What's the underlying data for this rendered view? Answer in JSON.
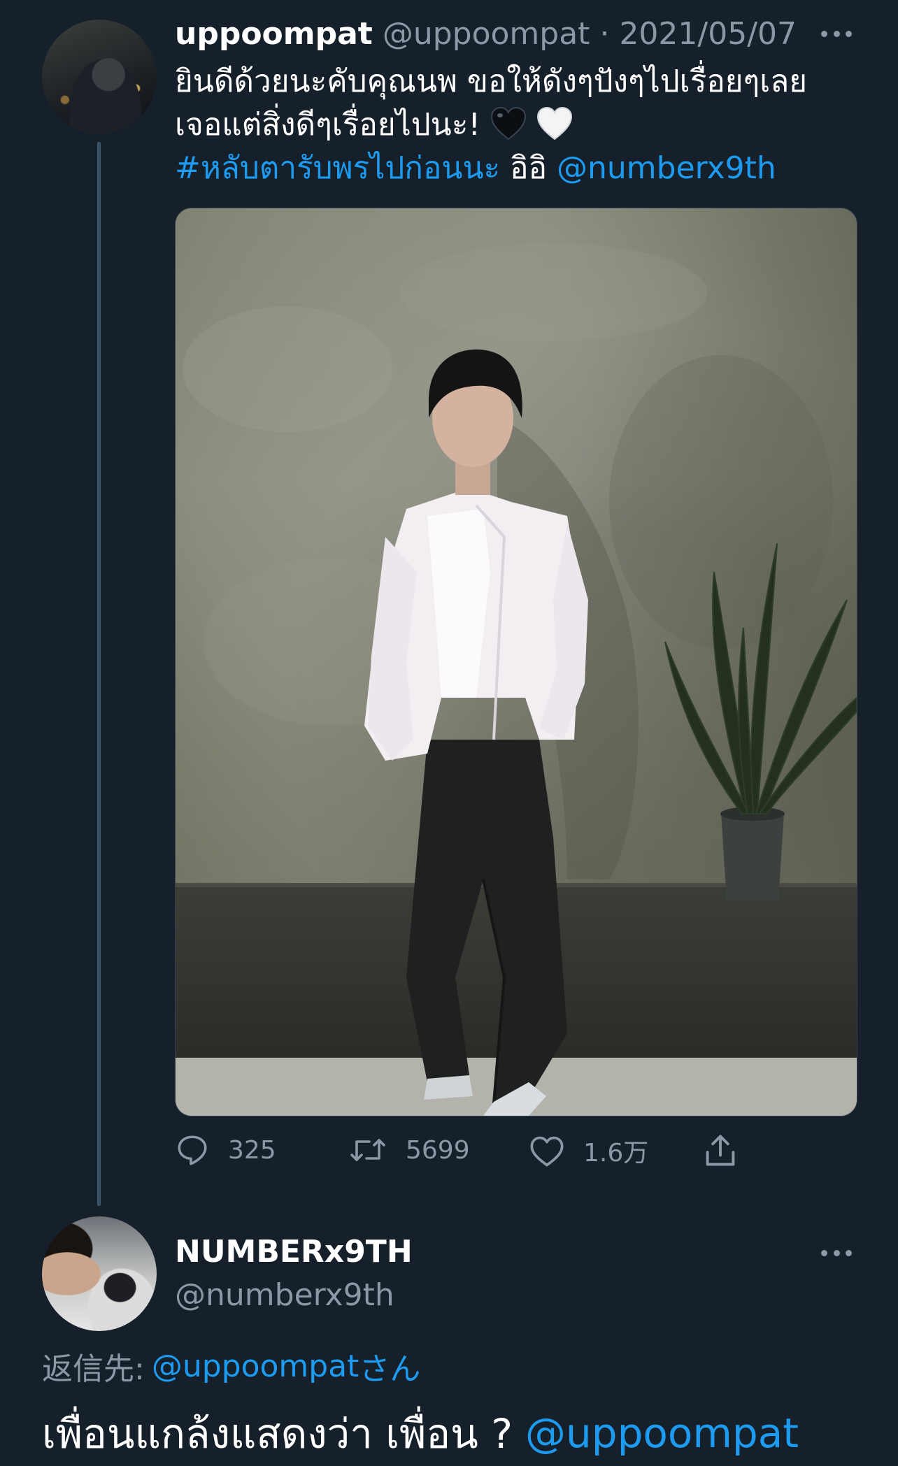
{
  "tweet1": {
    "display_name": "uppoompat",
    "handle": "@uppoompat",
    "separator": "·",
    "date": "2021/05/07",
    "text_line1": "ยินดีด้วยนะคับคุณนพ ขอให้ดังๆปังๆไปเรื่อยๆเลย",
    "text_line2": "เจอแต่สิ่งดีๆเรื่อยไปนะ!",
    "hashtag": "#หลับตารับพรไปก่อนนะ",
    "text_after_hashtag": "อิอิ",
    "mention": "@numberx9th",
    "emojis": [
      "black-heart",
      "white-heart"
    ],
    "stats": {
      "replies": "325",
      "retweets": "5699",
      "likes": "1.6万"
    }
  },
  "tweet2": {
    "display_name": "NUMBERx9TH",
    "handle": "@numberx9th",
    "reply_to_prefix": "返信先:",
    "reply_to_user": "@uppoompat",
    "reply_to_suffix": "さん",
    "text": "เพื่อนแกล้งแสดงว่า เพื่อน ?",
    "mention": "@uppoompat"
  },
  "colors": {
    "background": "#15202b",
    "text_primary": "#ffffff",
    "text_secondary": "#8b98a5",
    "link": "#1d9bf0",
    "thread_line": "#3d5466"
  },
  "icons": [
    "more-icon",
    "reply-icon",
    "retweet-icon",
    "like-icon",
    "share-icon"
  ]
}
